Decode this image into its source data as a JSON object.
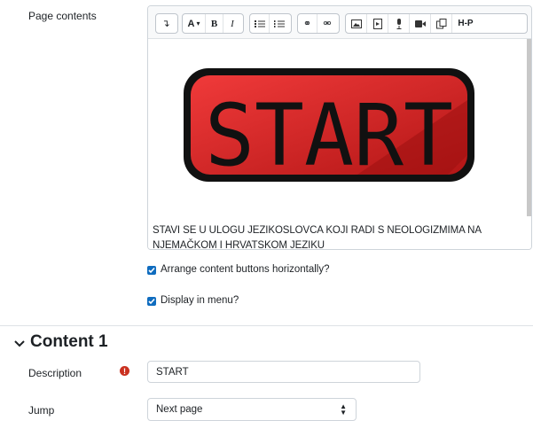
{
  "form": {
    "page_contents_label": "Page contents",
    "editor": {
      "toolbar": {
        "group1": [
          "↴"
        ],
        "group2": [
          "A",
          "B",
          "I"
        ],
        "group3": [
          "unordered-list",
          "ordered-list"
        ],
        "group4": [
          "link",
          "unlink"
        ],
        "group5": [
          "image",
          "media",
          "microphone",
          "video",
          "manage-files",
          "H-P"
        ]
      },
      "image_text": "START",
      "text": "STAVI SE U ULOGU JEZIKOSLOVCA KOJI RADI S NEOLOGIZMIMA NA NJEMAČKOM I HRVATSKOM JEZIKU"
    },
    "arrange_label": "Arrange content buttons horizontally?",
    "display_menu_label": "Display in menu?",
    "section_title": "Content 1",
    "description_label": "Description",
    "description_value": "START",
    "jump_label": "Jump",
    "jump_value": "Next page"
  }
}
